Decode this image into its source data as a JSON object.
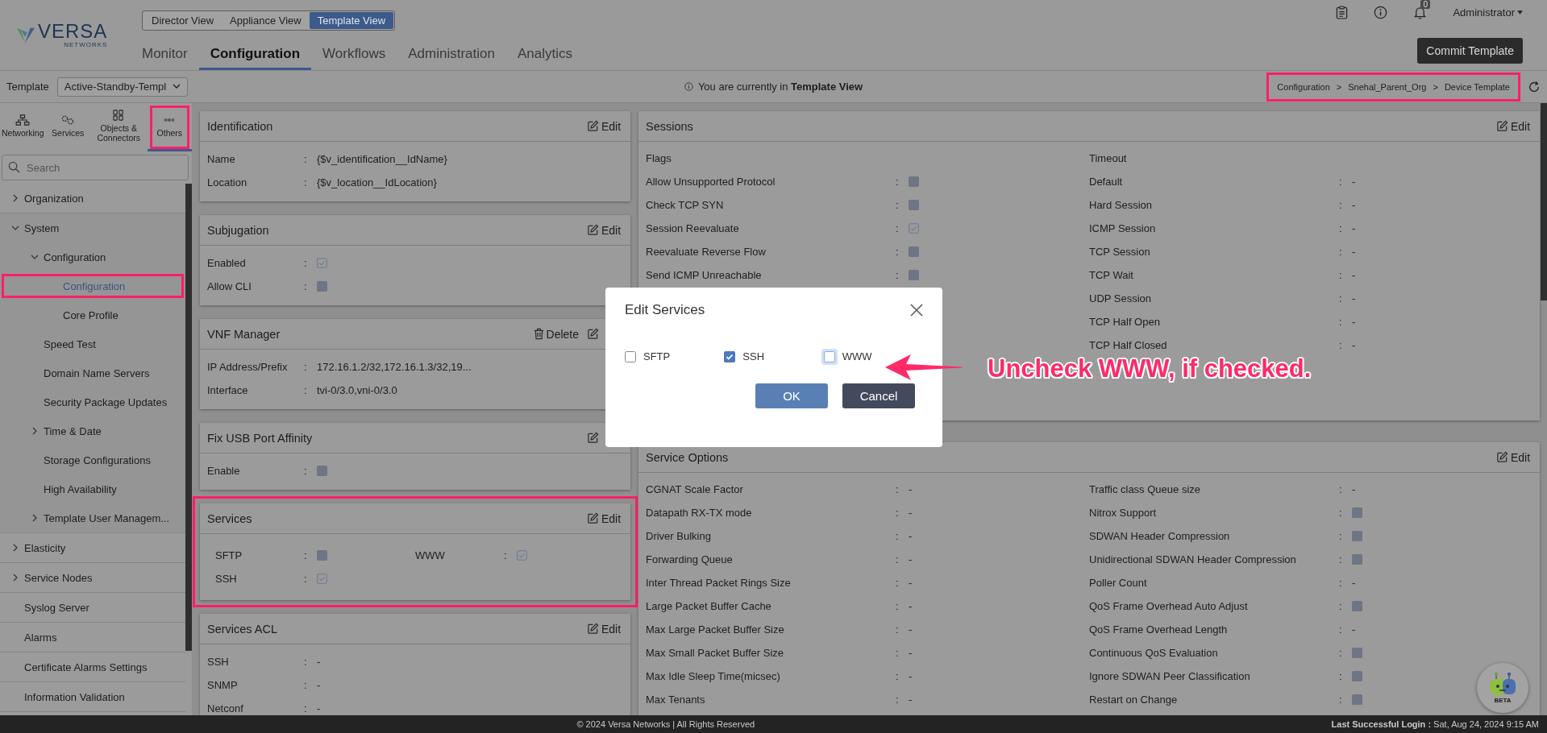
{
  "header": {
    "logo": "VERSA",
    "logo_sub": "NETWORKS",
    "views": [
      {
        "label": "Director View",
        "selected": false
      },
      {
        "label": "Appliance View",
        "selected": false
      },
      {
        "label": "Template View",
        "selected": true
      }
    ],
    "nav": [
      {
        "label": "Monitor",
        "selected": false
      },
      {
        "label": "Configuration",
        "selected": true
      },
      {
        "label": "Workflows",
        "selected": false
      },
      {
        "label": "Administration",
        "selected": false
      },
      {
        "label": "Analytics",
        "selected": false
      }
    ],
    "notification_count": "0",
    "user": "Administrator",
    "commit_button": "Commit Template"
  },
  "template_bar": {
    "label": "Template",
    "value": "Active-Standby-Templ",
    "info": "You are currently in **Template View**",
    "breadcrumb": {
      "items": [
        "Configuration",
        "Snehal_Parent_Org",
        "Device Template"
      ],
      "separator": ">",
      "highlighted": true
    }
  },
  "sidebar": {
    "tabs": [
      {
        "label": "Networking",
        "selected": false,
        "highlighted": false
      },
      {
        "label": "Services",
        "selected": false,
        "highlighted": false
      },
      {
        "label": "Objects & Connectors",
        "selected": false,
        "highlighted": false
      },
      {
        "label": "Others",
        "selected": true,
        "highlighted": true
      }
    ],
    "search_placeholder": "Search",
    "tree": [
      {
        "label": "Organization",
        "kind": "folder",
        "expanded": false,
        "selected": false,
        "highlighted": false
      },
      {
        "label": "System",
        "kind": "folder",
        "expanded": true,
        "selected": false,
        "highlighted": false,
        "children": [
          {
            "label": "Configuration",
            "kind": "folder",
            "expanded": true,
            "selected": false,
            "highlighted": false,
            "children": [
              {
                "label": "Configuration",
                "kind": "item",
                "selected": true,
                "highlighted": true
              },
              {
                "label": "Core Profile",
                "kind": "item",
                "selected": false,
                "highlighted": false
              }
            ]
          },
          {
            "label": "Speed Test",
            "kind": "item",
            "selected": false,
            "highlighted": false
          },
          {
            "label": "Domain Name Servers",
            "kind": "item",
            "selected": false,
            "highlighted": false
          },
          {
            "label": "Security Package Updates",
            "kind": "item",
            "selected": false,
            "highlighted": false
          },
          {
            "label": "Time & Date",
            "kind": "folder",
            "expanded": false,
            "selected": false,
            "highlighted": false
          },
          {
            "label": "Storage Configurations",
            "kind": "item",
            "selected": false,
            "highlighted": false
          },
          {
            "label": "High Availability",
            "kind": "item",
            "selected": false,
            "highlighted": false
          },
          {
            "label": "Template User Managem...",
            "kind": "folder",
            "expanded": false,
            "selected": false,
            "highlighted": false
          }
        ]
      },
      {
        "label": "Elasticity",
        "kind": "folder",
        "expanded": false,
        "selected": false,
        "highlighted": false
      },
      {
        "label": "Service Nodes",
        "kind": "folder",
        "expanded": false,
        "selected": false,
        "highlighted": false
      },
      {
        "label": "Syslog Server",
        "kind": "item",
        "selected": false,
        "highlighted": false
      },
      {
        "label": "Alarms",
        "kind": "item",
        "selected": false,
        "highlighted": false
      },
      {
        "label": "Certificate Alarms Settings",
        "kind": "item",
        "selected": false,
        "highlighted": false
      },
      {
        "label": "Information Validation",
        "kind": "item",
        "selected": false,
        "highlighted": false
      }
    ]
  },
  "left_panels": [
    {
      "title": "Identification",
      "kind": "aligned",
      "highlighted": false,
      "actions": [
        {
          "kind": "edit",
          "label": "Edit"
        }
      ],
      "columns": [
        {
          "fields": [
            {
              "label": "Name",
              "sep": ":",
              "kind": "text",
              "value": "{$v_identification__IdName}"
            },
            {
              "label": "Location",
              "sep": ":",
              "kind": "text",
              "value": "{$v_location__IdLocation}"
            }
          ]
        }
      ]
    },
    {
      "title": "Subjugation",
      "kind": "aligned",
      "highlighted": false,
      "actions": [
        {
          "kind": "edit",
          "label": "Edit"
        }
      ],
      "columns": [
        {
          "fields": [
            {
              "label": "Enabled",
              "sep": ":",
              "kind": "checkbox",
              "checked": true
            },
            {
              "label": "Allow CLI",
              "sep": ":",
              "kind": "checkbox",
              "checked": false
            }
          ]
        }
      ]
    },
    {
      "title": "VNF Manager",
      "kind": "aligned",
      "highlighted": false,
      "actions": [
        {
          "kind": "delete",
          "label": "Delete"
        },
        {
          "kind": "edit"
        }
      ],
      "columns": [
        {
          "fields": [
            {
              "label": "IP Address/Prefix",
              "sep": ":",
              "kind": "text",
              "value": "172.16.1.2/32,172.16.1.3/32,19..."
            },
            {
              "label": "Interface",
              "sep": ":",
              "kind": "text",
              "value": "tvi-0/3.0,vni-0/3.0"
            }
          ]
        }
      ]
    },
    {
      "title": "Fix USB Port Affinity",
      "kind": "aligned",
      "highlighted": false,
      "actions": [
        {
          "kind": "edit"
        }
      ],
      "columns": [
        {
          "fields": [
            {
              "label": "Enable",
              "sep": ":",
              "kind": "checkbox",
              "checked": false
            }
          ]
        }
      ]
    },
    {
      "title": "Services",
      "kind": "aligned",
      "highlighted": true,
      "actions": [
        {
          "kind": "edit",
          "label": "Edit"
        }
      ],
      "columns": [
        {
          "fields": [
            {
              "label": "SFTP",
              "sep": ":",
              "kind": "checkbox",
              "checked": false
            },
            {
              "label": "SSH",
              "sep": ":",
              "kind": "checkbox",
              "checked": true
            }
          ]
        },
        {
          "fields": [
            {
              "label": "WWW",
              "sep": ":",
              "kind": "checkbox",
              "checked": true
            }
          ]
        }
      ]
    },
    {
      "title": "Services ACL",
      "kind": "aligned",
      "highlighted": false,
      "actions": [
        {
          "kind": "edit",
          "label": "Edit"
        }
      ],
      "columns": [
        {
          "fields": [
            {
              "label": "SSH",
              "sep": ":",
              "kind": "text",
              "value": "-"
            },
            {
              "label": "SNMP",
              "sep": ":",
              "kind": "text",
              "value": "-"
            },
            {
              "label": "Netconf",
              "sep": ":",
              "kind": "text",
              "value": "-"
            }
          ]
        }
      ]
    }
  ],
  "right_panels": [
    {
      "title": "Sessions",
      "kind": "aligned",
      "highlighted": false,
      "actions": [
        {
          "kind": "edit",
          "label": "Edit"
        }
      ],
      "columns": [
        {
          "heading": "Flags",
          "fields": [
            {
              "label": "Allow Unsupported Protocol",
              "sep": ":",
              "kind": "checkbox",
              "checked": false
            },
            {
              "label": "Check TCP SYN",
              "sep": ":",
              "kind": "checkbox",
              "checked": false
            },
            {
              "label": "Session Reevaluate",
              "sep": ":",
              "kind": "checkbox",
              "checked": true
            },
            {
              "label": "Reevaluate Reverse Flow",
              "sep": ":",
              "kind": "checkbox",
              "checked": false
            },
            {
              "label": "Send ICMP Unreachable",
              "sep": ":",
              "kind": "checkbox",
              "checked": false
            }
          ]
        },
        {
          "heading": "Timeout",
          "fields": [
            {
              "label": "Default",
              "sep": ":",
              "kind": "text",
              "value": "-"
            },
            {
              "label": "Hard Session",
              "sep": ":",
              "kind": "text",
              "value": "-"
            },
            {
              "label": "ICMP Session",
              "sep": ":",
              "kind": "text",
              "value": "-"
            },
            {
              "label": "TCP Session",
              "sep": ":",
              "kind": "text",
              "value": "-"
            },
            {
              "label": "TCP Wait",
              "sep": ":",
              "kind": "text",
              "value": "-"
            },
            {
              "label": "UDP Session",
              "sep": ":",
              "kind": "text",
              "value": "-"
            },
            {
              "label": "TCP Half Open",
              "sep": ":",
              "kind": "text",
              "value": "-"
            },
            {
              "label": "TCP Half Closed",
              "sep": ":",
              "kind": "text",
              "value": "-"
            }
          ]
        }
      ]
    },
    {
      "title": "Service Options",
      "kind": "aligned",
      "highlighted": false,
      "actions": [
        {
          "kind": "edit",
          "label": "Edit"
        }
      ],
      "columns": [
        {
          "fields": [
            {
              "label": "CGNAT Scale Factor",
              "sep": ":",
              "kind": "text",
              "value": "-"
            },
            {
              "label": "Datapath RX-TX mode",
              "sep": ":",
              "kind": "text",
              "value": "-"
            },
            {
              "label": "Driver Bulking",
              "sep": ":",
              "kind": "text",
              "value": "-"
            },
            {
              "label": "Forwarding Queue",
              "sep": ":",
              "kind": "text",
              "value": "-"
            },
            {
              "label": "Inter Thread Packet Rings Size",
              "sep": ":",
              "kind": "text",
              "value": "-"
            },
            {
              "label": "Large Packet Buffer Cache",
              "sep": ":",
              "kind": "text",
              "value": "-"
            },
            {
              "label": "Max Large Packet Buffer Size",
              "sep": ":",
              "kind": "text",
              "value": "-"
            },
            {
              "label": "Max Small Packet Buffer Size",
              "sep": ":",
              "kind": "text",
              "value": "-"
            },
            {
              "label": "Max Idle Sleep Time(micsec)",
              "sep": ":",
              "kind": "text",
              "value": "-"
            },
            {
              "label": "Max Tenants",
              "sep": ":",
              "kind": "text",
              "value": "-"
            }
          ]
        },
        {
          "fields": [
            {
              "label": "Traffic class Queue size",
              "sep": ":",
              "kind": "text",
              "value": "-"
            },
            {
              "label": "Nitrox Support",
              "sep": ":",
              "kind": "checkbox",
              "checked": false
            },
            {
              "label": "SDWAN Header Compression",
              "sep": ":",
              "kind": "checkbox",
              "checked": false
            },
            {
              "label": "Unidirectional SDWAN Header Compression",
              "sep": ":",
              "kind": "checkbox",
              "checked": false
            },
            {
              "label": "Poller Count",
              "sep": ":",
              "kind": "text",
              "value": "-"
            },
            {
              "label": "QoS Frame Overhead Auto Adjust",
              "sep": ":",
              "kind": "checkbox",
              "checked": false
            },
            {
              "label": "QoS Frame Overhead Length",
              "sep": ":",
              "kind": "text",
              "value": "-"
            },
            {
              "label": "Continuous QoS Evaluation",
              "sep": ":",
              "kind": "checkbox",
              "checked": false
            },
            {
              "label": "Ignore SDWAN Peer Classification",
              "sep": ":",
              "kind": "checkbox",
              "checked": false
            },
            {
              "label": "Restart on Change",
              "sep": ":",
              "kind": "checkbox",
              "checked": false
            }
          ]
        }
      ]
    }
  ],
  "modal": {
    "title": "Edit Services",
    "options": [
      {
        "label": "SFTP",
        "checked": false,
        "focused": false
      },
      {
        "label": "SSH",
        "checked": true,
        "focused": false
      },
      {
        "label": "WWW",
        "checked": false,
        "focused": true
      }
    ],
    "buttons": [
      {
        "label": "OK",
        "kind": "primary"
      },
      {
        "label": "Cancel",
        "kind": "secondary"
      }
    ]
  },
  "callout": {
    "text": "Uncheck WWW, if checked."
  },
  "assistant": {
    "badge": "BETA"
  },
  "footer": {
    "copyright": "© 2024 Versa Networks | All Rights Reserved",
    "login": "**Last Successful Login :** Sat, Aug 24, 2024 9:15 AM"
  }
}
